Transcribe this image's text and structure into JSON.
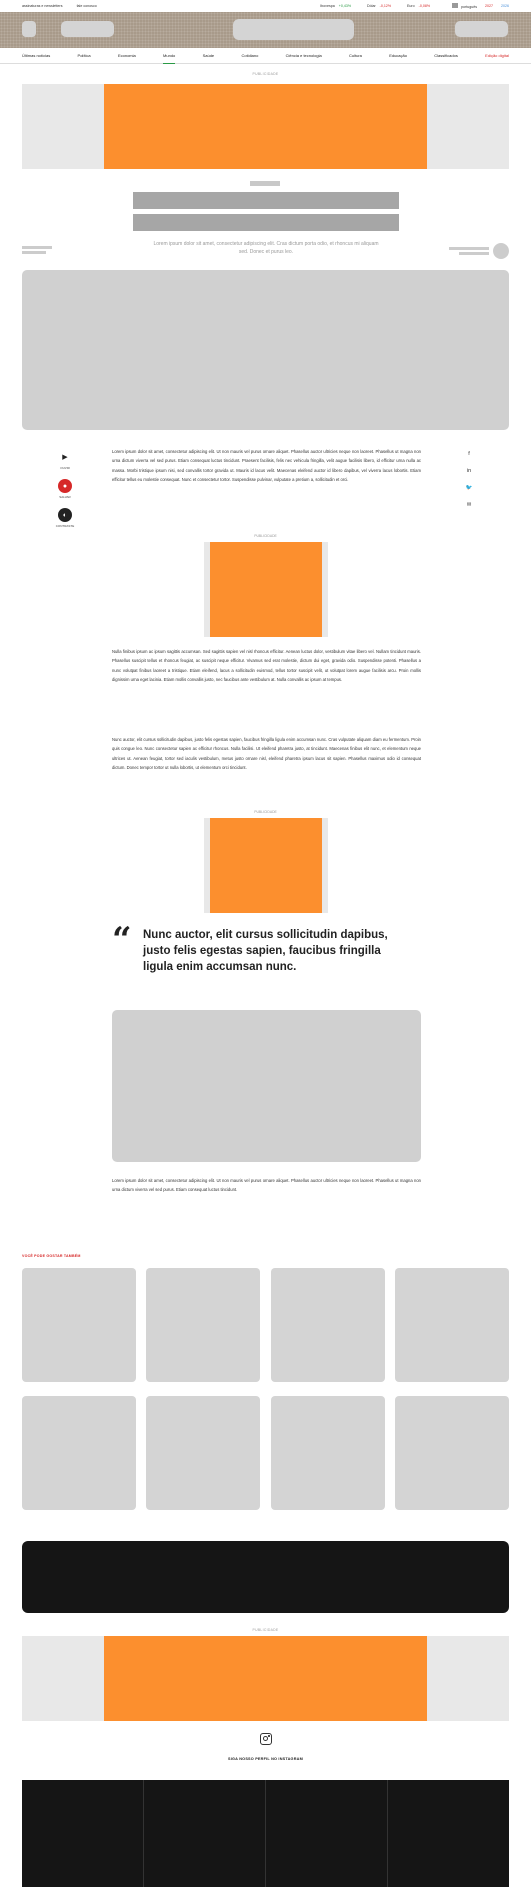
{
  "topbar": {
    "left_links": [
      "assinaturas e newsletters",
      "fale conosco"
    ],
    "markets": [
      {
        "label": "Ibovespa",
        "value": "+0,43%",
        "trend": "up"
      },
      {
        "label": "Dólar",
        "value": "-0,12%",
        "trend": "down"
      },
      {
        "label": "Euro",
        "value": "-0,08%",
        "trend": "down"
      }
    ],
    "lang_label": "português",
    "ticker_a": "2027",
    "ticker_b": "2026"
  },
  "nav": {
    "items": [
      {
        "label": "Últimas notícias",
        "state": ""
      },
      {
        "label": "Política",
        "state": ""
      },
      {
        "label": "Economia",
        "state": ""
      },
      {
        "label": "Mundo",
        "state": "active"
      },
      {
        "label": "Saúde",
        "state": ""
      },
      {
        "label": "Cotidiano",
        "state": ""
      },
      {
        "label": "Ciência e tecnologia",
        "state": ""
      },
      {
        "label": "Cultura",
        "state": ""
      },
      {
        "label": "Educação",
        "state": ""
      },
      {
        "label": "Classificados",
        "state": ""
      },
      {
        "label": "Edição digital",
        "state": "highlight"
      }
    ]
  },
  "ads": {
    "label": "PUBLICIDADE"
  },
  "article": {
    "subtitle": "Lorem ipsum dolor sit amet, consectetur adipiscing elit. Cras dictum porta odio, et rhoncus mi aliquam sed. Donec et purus leo.",
    "paragraphs": [
      "Lorem ipsum dolor sit amet, consectetur adipiscing elit. Ut non mauris vel purus ornare aliquet. Phasellus auctor ultricies neque non laoreet. Phasellus ut magna non urna dictum viverra vel sed purus. Etiam consequat luctus tincidunt. Praesent facilisis, felis nec vehicula fringilla, velit augue facilisis libero, id efficitur urna nulla ac massa. Morbi tristique ipsum nisi, sed convallis tortor gravida ut. Mauris id lacus velit. Maecenas eleifend auctor id libero dapibus, vel viverra lacus lobortis. Etiam efficitur tellus eu molestie consequat. Nunc et consectetur tortor. Suspendisse pulvinar, vulputate a pretium a, sollicitudin et orci.",
      "Nulla finibus ipsum ac ipsum sagittis accumsan. Sed sagittis sapien vel nisl rhoncus efficitur. Aenean luctus dolor, vestibulum vitae libero vel. Nullam tincidunt mauris. Phasellus suscipit tellus et rhoncus feugiat, ac suscipit neque efficitur. Vivamus sed erat molestie, dictum dui eget, gravida odio. Suspendisse potenti. Phasellus a nunc volutpat finibus laoreet a tristique. Etiam eleifend, lacus a sollicitudin euismod, tellus tortor suscipit velit, ut volutpat lorem augue facilisis arcu. Proin mollis dignissim urna eget lacinia. Etiam mollis convallis justo, nec faucibus ante vestibulum at. Nulla convallis ac ipsum at tempus.",
      "Nunc auctor, elit cursus sollicitudin dapibus, justo felis egestas sapien, faucibus fringilla ligula enim accumsan nunc. Cras vulputate aliquam diam eu fermentum. Proin quis congue leo. Nunc consectetur sapien ac efficitur rhoncus. Nulla facilisi. Ut eleifend pharetra justo, at tincidunt. Maecenas finibus elit nunc, et elementum neque ultrices ut. Aenean feugiat, tortor sed iaculis vestibulum, metus justo ornare nisl, eleifend pharetra ipsum lacus sit sapien. Phasellus maximus odio id consequat dictum. Donec tempor tortor ut nulla lobortis, ut elementum orci tincidunt.",
      "Lorem ipsum dolor sit amet, consectetur adipiscing elit. Ut non mauris vel purus ornare aliquet. Phasellus auctor ultricies neque non laoreet. Phasellus ut magna non urna dictum viverra vel sed purus. Etiam consequat luctus tincidunt."
    ],
    "quote": "Nunc auctor, elit cursus sollicitudin dapibus, justo felis egestas sapien, faucibus fringilla ligula enim accumsan nunc."
  },
  "left_rail": [
    {
      "icon": "play-icon",
      "glyph": "▶",
      "label": "OUVIR"
    },
    {
      "icon": "comment-icon",
      "glyph": "●",
      "label": "SALVAR"
    },
    {
      "icon": "contrast-icon",
      "glyph": "◐",
      "label": "CONTRASTE"
    }
  ],
  "right_rail": [
    {
      "icon": "facebook-icon",
      "glyph": "f"
    },
    {
      "icon": "linkedin-icon",
      "glyph": "in"
    },
    {
      "icon": "twitter-icon",
      "glyph": "🐦"
    },
    {
      "icon": "email-icon",
      "glyph": "✉"
    }
  ],
  "related": {
    "title": "VOCÊ PODE GOSTAR TAMBÉM"
  },
  "instagram": {
    "title": "SIGA NOSSO PERFIL NO INSTAGRAM"
  },
  "colors": {
    "accent_green": "#2a9a45",
    "accent_red": "#d62828",
    "ad_orange": "#fc8f2e"
  }
}
